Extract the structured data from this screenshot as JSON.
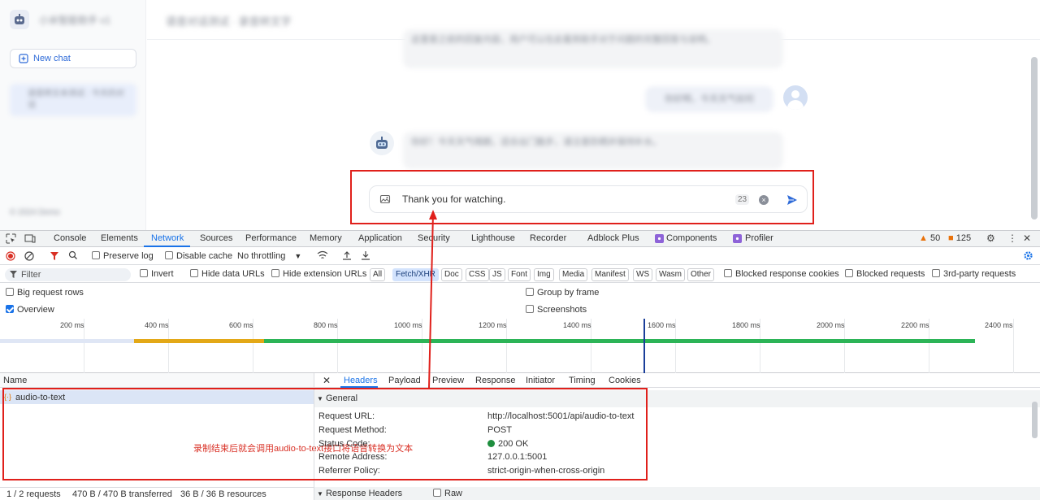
{
  "app": {
    "name_blurred": "小米智能助手 v1",
    "new_chat": "New chat",
    "conversation_blurred": "语音转文本测试 · 今天的对话",
    "side_footer_blurred": "© 2024 Demo",
    "chat_title_blurred": "语音对话测试 · 录音转文字",
    "bubble1_blurred": "这里是之前的回复内容，用户可以在此看到助手对于问题的完整回答与说明。",
    "bubble2_blurred": "你好啊，今天天气如何",
    "bubble3_blurred": "你好！今天天气晴朗，适合出门散步，请注意防晒并保持补水。",
    "input_text": "Thank you for watching.",
    "char_count": "23"
  },
  "devtools": {
    "tabs": [
      "Elements",
      "Network",
      "Sources",
      "Performance",
      "Memory",
      "Application",
      "Security",
      "Lighthouse",
      "Recorder",
      "Adblock Plus",
      "Components",
      "Profiler"
    ],
    "console": "Console",
    "warnings": "50",
    "errors": "125",
    "preserve_log": "Preserve log",
    "disable_cache": "Disable cache",
    "throttling": "No throttling",
    "filter_placeholder": "Filter",
    "invert": "Invert",
    "hide_data_urls": "Hide data URLs",
    "hide_extension_urls": "Hide extension URLs",
    "type_chips": [
      "All",
      "Fetch/XHR",
      "Doc",
      "CSS",
      "JS",
      "Font",
      "Img",
      "Media",
      "Manifest",
      "WS",
      "Wasm",
      "Other"
    ],
    "blocked_cookies": "Blocked response cookies",
    "blocked_requests": "Blocked requests",
    "third_party": "3rd-party requests",
    "big_rows": "Big request rows",
    "group_by_frame": "Group by frame",
    "overview": "Overview",
    "screenshots": "Screenshots",
    "ticks": [
      "200 ms",
      "400 ms",
      "600 ms",
      "800 ms",
      "1000 ms",
      "1200 ms",
      "1400 ms",
      "1600 ms",
      "1800 ms",
      "2000 ms",
      "2200 ms",
      "2400 ms"
    ],
    "annotation": "录制结束后就会调用audio-to-text接口将语音转换为文本",
    "name_header": "Name",
    "request_name": "audio-to-text",
    "detail_tabs": [
      "Headers",
      "Payload",
      "Preview",
      "Response",
      "Initiator",
      "Timing",
      "Cookies"
    ],
    "general": "General",
    "fields": [
      {
        "k": "Request URL:",
        "v": "http://localhost:5001/api/audio-to-text"
      },
      {
        "k": "Request Method:",
        "v": "POST"
      },
      {
        "k": "Status Code:",
        "v": "200 OK"
      },
      {
        "k": "Remote Address:",
        "v": "127.0.0.1:5001"
      },
      {
        "k": "Referrer Policy:",
        "v": "strict-origin-when-cross-origin"
      }
    ],
    "footer": {
      "requests": "1 / 2 requests",
      "transferred": "470 B / 470 B transferred",
      "resources": "36 B / 36 B resources"
    },
    "response_headers": "Response Headers",
    "raw": "Raw"
  },
  "colors": {
    "accent": "#1a73e8",
    "annotation_red": "#e0201b",
    "status_green": "#1e8e3e"
  }
}
